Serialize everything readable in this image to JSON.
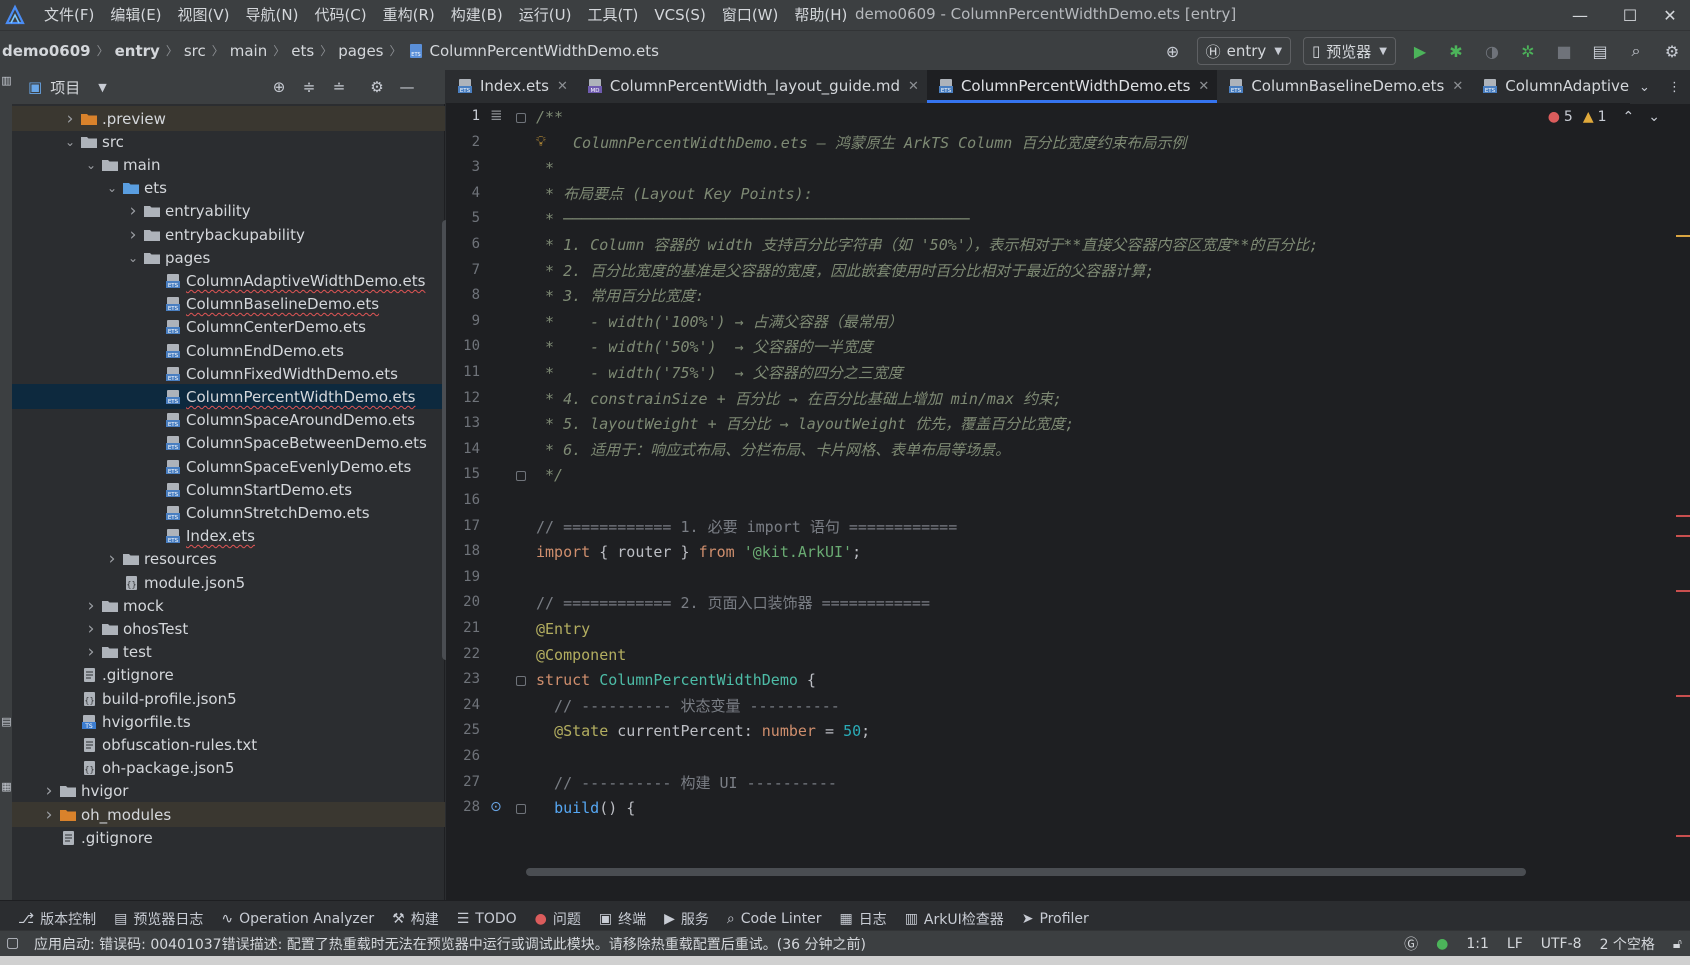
{
  "window": {
    "title": "demo0609 - ColumnPercentWidthDemo.ets [entry]"
  },
  "menu": [
    {
      "label": "文件(F)"
    },
    {
      "label": "编辑(E)"
    },
    {
      "label": "视图(V)"
    },
    {
      "label": "导航(N)"
    },
    {
      "label": "代码(C)"
    },
    {
      "label": "重构(R)"
    },
    {
      "label": "构建(B)"
    },
    {
      "label": "运行(U)"
    },
    {
      "label": "工具(T)"
    },
    {
      "label": "VCS(S)"
    },
    {
      "label": "窗口(W)"
    },
    {
      "label": "帮助(H)"
    }
  ],
  "breadcrumb": [
    "demo0609",
    "entry",
    "src",
    "main",
    "ets",
    "pages",
    "ColumnPercentWidthDemo.ets"
  ],
  "toolbar": {
    "module": "entry",
    "device": "预览器"
  },
  "project": {
    "title": "项目",
    "tree": [
      {
        "label": ".preview",
        "depth": 2,
        "kind": "folder-orange",
        "chev": "right",
        "excluded": true
      },
      {
        "label": "src",
        "depth": 2,
        "kind": "folder",
        "chev": "down"
      },
      {
        "label": "main",
        "depth": 3,
        "kind": "folder",
        "chev": "down"
      },
      {
        "label": "ets",
        "depth": 4,
        "kind": "folder-blue",
        "chev": "down"
      },
      {
        "label": "entryability",
        "depth": 5,
        "kind": "folder",
        "chev": "right"
      },
      {
        "label": "entrybackupability",
        "depth": 5,
        "kind": "folder",
        "chev": "right"
      },
      {
        "label": "pages",
        "depth": 5,
        "kind": "folder",
        "chev": "down"
      },
      {
        "label": "ColumnAdaptiveWidthDemo.ets",
        "depth": 6,
        "kind": "ets",
        "squiggle": true
      },
      {
        "label": "ColumnBaselineDemo.ets",
        "depth": 6,
        "kind": "ets",
        "squiggle": true
      },
      {
        "label": "ColumnCenterDemo.ets",
        "depth": 6,
        "kind": "ets"
      },
      {
        "label": "ColumnEndDemo.ets",
        "depth": 6,
        "kind": "ets"
      },
      {
        "label": "ColumnFixedWidthDemo.ets",
        "depth": 6,
        "kind": "ets"
      },
      {
        "label": "ColumnPercentWidthDemo.ets",
        "depth": 6,
        "kind": "ets",
        "squiggle": true,
        "selected": true
      },
      {
        "label": "ColumnSpaceAroundDemo.ets",
        "depth": 6,
        "kind": "ets"
      },
      {
        "label": "ColumnSpaceBetweenDemo.ets",
        "depth": 6,
        "kind": "ets"
      },
      {
        "label": "ColumnSpaceEvenlyDemo.ets",
        "depth": 6,
        "kind": "ets"
      },
      {
        "label": "ColumnStartDemo.ets",
        "depth": 6,
        "kind": "ets"
      },
      {
        "label": "ColumnStretchDemo.ets",
        "depth": 6,
        "kind": "ets"
      },
      {
        "label": "Index.ets",
        "depth": 6,
        "kind": "ets",
        "squiggle": true
      },
      {
        "label": "resources",
        "depth": 4,
        "kind": "folder",
        "chev": "right"
      },
      {
        "label": "module.json5",
        "depth": 4,
        "kind": "json"
      },
      {
        "label": "mock",
        "depth": 3,
        "kind": "folder",
        "chev": "right"
      },
      {
        "label": "ohosTest",
        "depth": 3,
        "kind": "folder",
        "chev": "right"
      },
      {
        "label": "test",
        "depth": 3,
        "kind": "folder",
        "chev": "right"
      },
      {
        "label": ".gitignore",
        "depth": 2,
        "kind": "file"
      },
      {
        "label": "build-profile.json5",
        "depth": 2,
        "kind": "json"
      },
      {
        "label": "hvigorfile.ts",
        "depth": 2,
        "kind": "ts"
      },
      {
        "label": "obfuscation-rules.txt",
        "depth": 2,
        "kind": "file"
      },
      {
        "label": "oh-package.json5",
        "depth": 2,
        "kind": "json"
      },
      {
        "label": "hvigor",
        "depth": 1,
        "kind": "folder",
        "chev": "right"
      },
      {
        "label": "oh_modules",
        "depth": 1,
        "kind": "folder-orange",
        "chev": "right",
        "excluded": true
      },
      {
        "label": ".gitignore",
        "depth": 1,
        "kind": "file"
      }
    ]
  },
  "tabs": [
    {
      "label": "Index.ets",
      "kind": "ets"
    },
    {
      "label": "ColumnPercentWidth_layout_guide.md",
      "kind": "md"
    },
    {
      "label": "ColumnPercentWidthDemo.ets",
      "kind": "ets",
      "active": true
    },
    {
      "label": "ColumnBaselineDemo.ets",
      "kind": "ets"
    },
    {
      "label": "ColumnAdaptive",
      "kind": "ets"
    }
  ],
  "inspection": {
    "errors": "5",
    "warnings": "1"
  },
  "code_lines": [
    [
      [
        "c-doc",
        "/**"
      ]
    ],
    [
      [
        "c-doc",
        " ColumnPercentWidthDemo.ets — 鸿蒙原生 ArkTS Column 百分比宽度约束布局示例"
      ]
    ],
    [
      [
        "c-doc",
        " *"
      ]
    ],
    [
      [
        "c-doc",
        " * 布局要点 (Layout Key Points):"
      ]
    ],
    [
      [
        "c-doc",
        " * ─────────────────────────────────────────────"
      ]
    ],
    [
      [
        "c-doc",
        " * 1. Column 容器的 width 支持百分比字符串（如 '50%'），表示相对于**直接父容器内容区宽度**的百分比;"
      ]
    ],
    [
      [
        "c-doc",
        " * 2. 百分比宽度的基准是父容器的宽度，因此嵌套使用时百分比相对于最近的父容器计算;"
      ]
    ],
    [
      [
        "c-doc",
        " * 3. 常用百分比宽度:"
      ]
    ],
    [
      [
        "c-doc",
        " *    - width('100%') → 占满父容器（最常用）"
      ]
    ],
    [
      [
        "c-doc",
        " *    - width('50%')  → 父容器的一半宽度"
      ]
    ],
    [
      [
        "c-doc",
        " *    - width('75%')  → 父容器的四分之三宽度"
      ]
    ],
    [
      [
        "c-doc",
        " * 4. constrainSize + 百分比 → 在百分比基础上增加 min/max 约束;"
      ]
    ],
    [
      [
        "c-doc",
        " * 5. layoutWeight + 百分比 → layoutWeight 优先，覆盖百分比宽度;"
      ]
    ],
    [
      [
        "c-doc",
        " * 6. 适用于：响应式布局、分栏布局、卡片网格、表单布局等场景。"
      ]
    ],
    [
      [
        "c-doc",
        " */"
      ]
    ],
    [
      [
        "c-plain",
        ""
      ]
    ],
    [
      [
        "c-cmt",
        "// ============ 1. 必要 import 语句 ============"
      ]
    ],
    [
      [
        "c-kw",
        "import"
      ],
      [
        "c-plain",
        " { router } "
      ],
      [
        "c-kw",
        "from"
      ],
      [
        "c-plain",
        " "
      ],
      [
        "c-str",
        "'@kit.ArkUI'"
      ],
      [
        "c-plain",
        ";"
      ]
    ],
    [
      [
        "c-plain",
        ""
      ]
    ],
    [
      [
        "c-cmt",
        "// ============ 2. 页面入口装饰器 ============"
      ]
    ],
    [
      [
        "c-ann",
        "@Entry"
      ]
    ],
    [
      [
        "c-ann",
        "@Component"
      ]
    ],
    [
      [
        "c-kw",
        "struct"
      ],
      [
        "c-plain",
        " "
      ],
      [
        "c-cls",
        "ColumnPercentWidthDemo"
      ],
      [
        "c-plain",
        " {"
      ]
    ],
    [
      [
        "c-cmt",
        "  // ---------- 状态变量 ----------"
      ]
    ],
    [
      [
        "c-plain",
        "  "
      ],
      [
        "c-ann",
        "@State"
      ],
      [
        "c-plain",
        " currentPercent: "
      ],
      [
        "c-kw",
        "number"
      ],
      [
        "c-plain",
        " = "
      ],
      [
        "c-num",
        "50"
      ],
      [
        "c-plain",
        ";"
      ]
    ],
    [
      [
        "c-plain",
        ""
      ]
    ],
    [
      [
        "c-cmt",
        "  // ---------- 构建 UI ----------"
      ]
    ],
    [
      [
        "c-plain",
        "  "
      ],
      [
        "c-fn",
        "build"
      ],
      [
        "c-plain",
        "() {"
      ]
    ]
  ],
  "bottom_tools": [
    {
      "icon": "⎇",
      "label": "版本控制"
    },
    {
      "icon": "▤",
      "label": "预览器日志"
    },
    {
      "icon": "∿",
      "label": "Operation Analyzer"
    },
    {
      "icon": "⚒",
      "label": "构建"
    },
    {
      "icon": "☰",
      "label": "TODO"
    },
    {
      "icon": "●",
      "label": "问题"
    },
    {
      "icon": "▣",
      "label": "终端"
    },
    {
      "icon": "▶",
      "label": "服务"
    },
    {
      "icon": "⌕",
      "label": "Code Linter"
    },
    {
      "icon": "▦",
      "label": "日志"
    },
    {
      "icon": "▥",
      "label": "ArkUI检查器"
    },
    {
      "icon": "➤",
      "label": "Profiler"
    }
  ],
  "status": {
    "message": "应用启动: 错误码: 00401037错误描述: 配置了热重载时无法在预览器中运行或调试此模块。请移除热重载配置后重试。(36 分钟之前)",
    "position": "1:1",
    "line_sep": "LF",
    "encoding": "UTF-8",
    "indent": "2 个空格"
  },
  "colors": {
    "accent": "#3574f0",
    "selected_row": "#0d293e",
    "error": "#db5c5c",
    "warning": "#e0a93b"
  }
}
